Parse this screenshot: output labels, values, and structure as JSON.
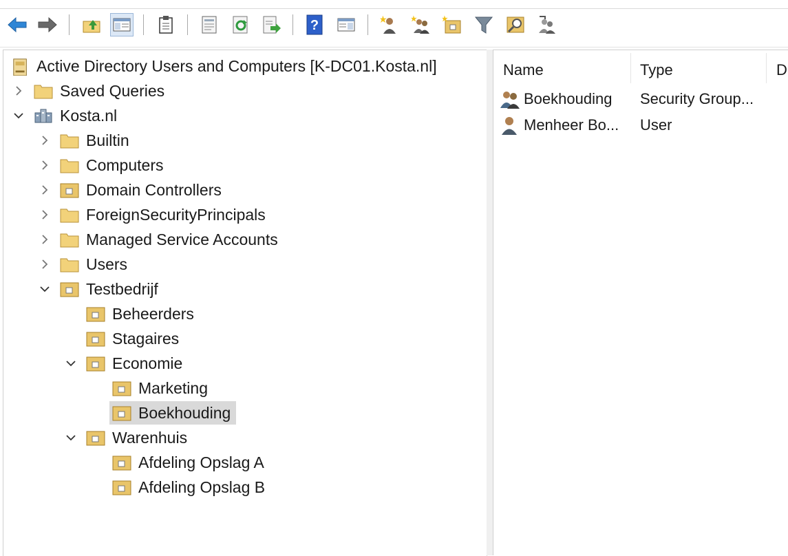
{
  "toolbar": {
    "buttons": [
      {
        "name": "back-icon",
        "color": "#2f86d6"
      },
      {
        "name": "forward-icon",
        "color": "#555555"
      },
      {
        "name": "up-one-level-icon"
      },
      {
        "name": "show-hide-console-tree-icon",
        "pressed": true
      },
      {
        "name": "clipboard-icon"
      },
      {
        "name": "properties-icon"
      },
      {
        "name": "refresh-icon"
      },
      {
        "name": "export-list-icon"
      },
      {
        "name": "help-icon"
      },
      {
        "name": "show-hide-action-pane-icon"
      },
      {
        "name": "create-user-icon"
      },
      {
        "name": "create-group-icon"
      },
      {
        "name": "create-ou-icon"
      },
      {
        "name": "filter-icon"
      },
      {
        "name": "find-icon"
      },
      {
        "name": "add-to-group-icon"
      }
    ]
  },
  "tree": {
    "root": "Active Directory Users and Computers [K-DC01.Kosta.nl]",
    "saved_queries": "Saved Queries",
    "domain": "Kosta.nl",
    "builtin": "Builtin",
    "computers": "Computers",
    "domain_controllers": "Domain Controllers",
    "foreign_security_principals": "ForeignSecurityPrincipals",
    "managed_service_accounts": "Managed Service Accounts",
    "users": "Users",
    "testbedrijf": "Testbedrijf",
    "beheerders": "Beheerders",
    "stagaires": "Stagaires",
    "economie": "Economie",
    "marketing": "Marketing",
    "boekhouding": "Boekhouding",
    "warenhuis": "Warenhuis",
    "afdeling_a": "Afdeling Opslag A",
    "afdeling_b": "Afdeling Opslag B",
    "selected": "Boekhouding"
  },
  "list": {
    "columns": [
      "Name",
      "Type",
      "D"
    ],
    "rows": [
      {
        "name": "Boekhouding",
        "type": "Security Group...",
        "icon": "group-icon"
      },
      {
        "name": "Menheer Bo...",
        "type": "User",
        "icon": "user-icon"
      }
    ]
  },
  "colors": {
    "folder": "#f2d27a",
    "ou_folder": "#e9c56a",
    "selection": "#d9d9d9",
    "accent_blue": "#2f86d6"
  }
}
